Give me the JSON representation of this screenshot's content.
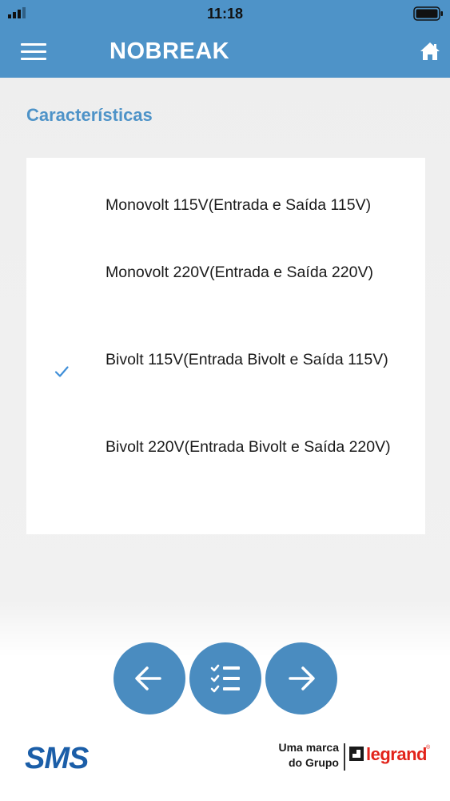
{
  "status_bar": {
    "time": "11:18"
  },
  "header": {
    "title": "NOBREAK",
    "menu_icon": "hamburger-icon",
    "home_icon": "home-icon"
  },
  "section": {
    "title": "Características"
  },
  "options": [
    {
      "label": "Monovolt 115V(Entrada e Saída 115V)",
      "selected": false
    },
    {
      "label": "Monovolt 220V(Entrada e Saída 220V)",
      "selected": false
    },
    {
      "label": "Bivolt 115V(Entrada Bivolt e Saída 115V)",
      "selected": true
    },
    {
      "label": "Bivolt 220V(Entrada Bivolt e Saída 220V)",
      "selected": false
    }
  ],
  "nav": {
    "back_icon": "arrow-left-icon",
    "list_icon": "checklist-icon",
    "next_icon": "arrow-right-icon"
  },
  "footer": {
    "logo_text": "SMS",
    "brand_line1": "Uma marca",
    "brand_line2": "do Grupo",
    "partner_logo": "legrand"
  },
  "colors": {
    "primary": "#4e93c8",
    "button": "#4a8cc0",
    "check": "#3f8fd8",
    "sms_blue": "#1b5ea8",
    "legrand_red": "#e2231a"
  }
}
